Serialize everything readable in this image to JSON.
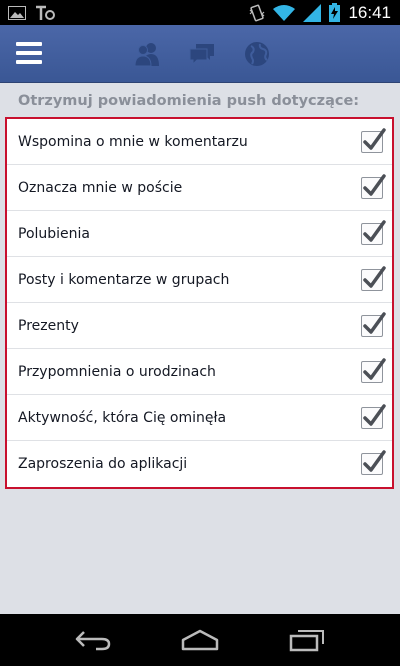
{
  "status_bar": {
    "time": "16:41",
    "icons": [
      "image-icon",
      "tango-icon",
      "vibrate-icon",
      "wifi-icon",
      "signal-icon",
      "battery-charging-icon"
    ]
  },
  "header": {
    "icons": [
      "menu-icon",
      "friends-icon",
      "messages-icon",
      "notifications-globe-icon"
    ],
    "bg_color": "#3b5998"
  },
  "section": {
    "heading": "Otrzymuj powiadomienia push dotyczące:"
  },
  "settings": [
    {
      "label": "Wspomina o mnie w komentarzu",
      "checked": true
    },
    {
      "label": "Oznacza mnie w poście",
      "checked": true
    },
    {
      "label": "Polubienia",
      "checked": true
    },
    {
      "label": "Posty i komentarze w grupach",
      "checked": true
    },
    {
      "label": "Prezenty",
      "checked": true
    },
    {
      "label": "Przypomnienia o urodzinach",
      "checked": true
    },
    {
      "label": "Aktywność, która Cię ominęła",
      "checked": true
    },
    {
      "label": "Zaproszenia do aplikacji",
      "checked": true
    }
  ],
  "nav_bar": {
    "icons": [
      "back-icon",
      "home-icon",
      "recent-apps-icon"
    ]
  },
  "colors": {
    "highlight_border": "#c8102e",
    "checkmark": "#4b4f56"
  }
}
